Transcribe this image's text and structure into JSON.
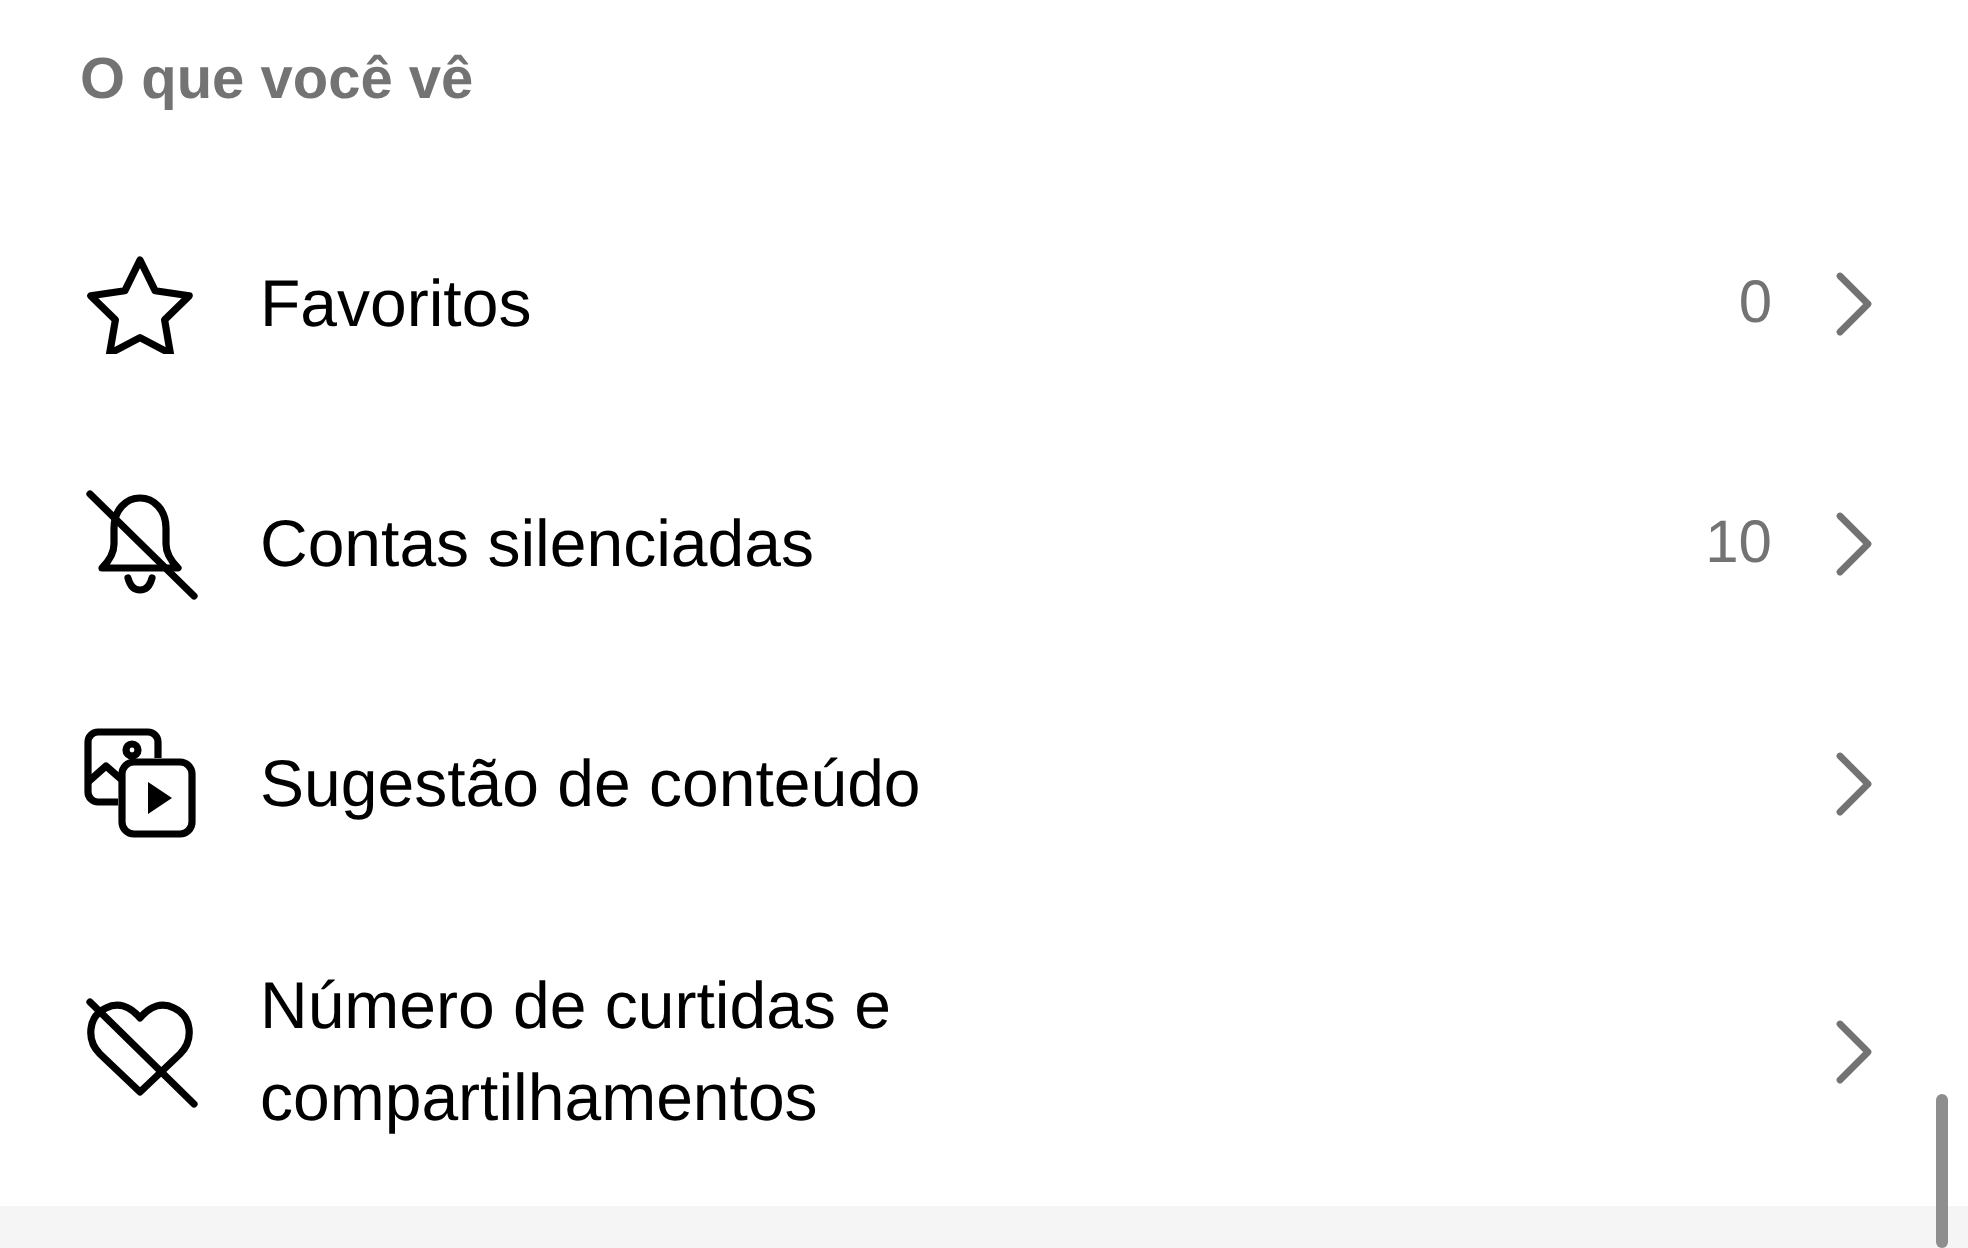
{
  "section": {
    "title": "O que você vê",
    "items": [
      {
        "kind": "favorites",
        "label": "Favoritos",
        "count": "0"
      },
      {
        "kind": "muted",
        "label": "Contas silenciadas",
        "count": "10"
      },
      {
        "kind": "suggested",
        "label": "Sugestão de conteúdo"
      },
      {
        "kind": "likes",
        "label": "Número de curtidas e compartilhamentos"
      }
    ]
  }
}
